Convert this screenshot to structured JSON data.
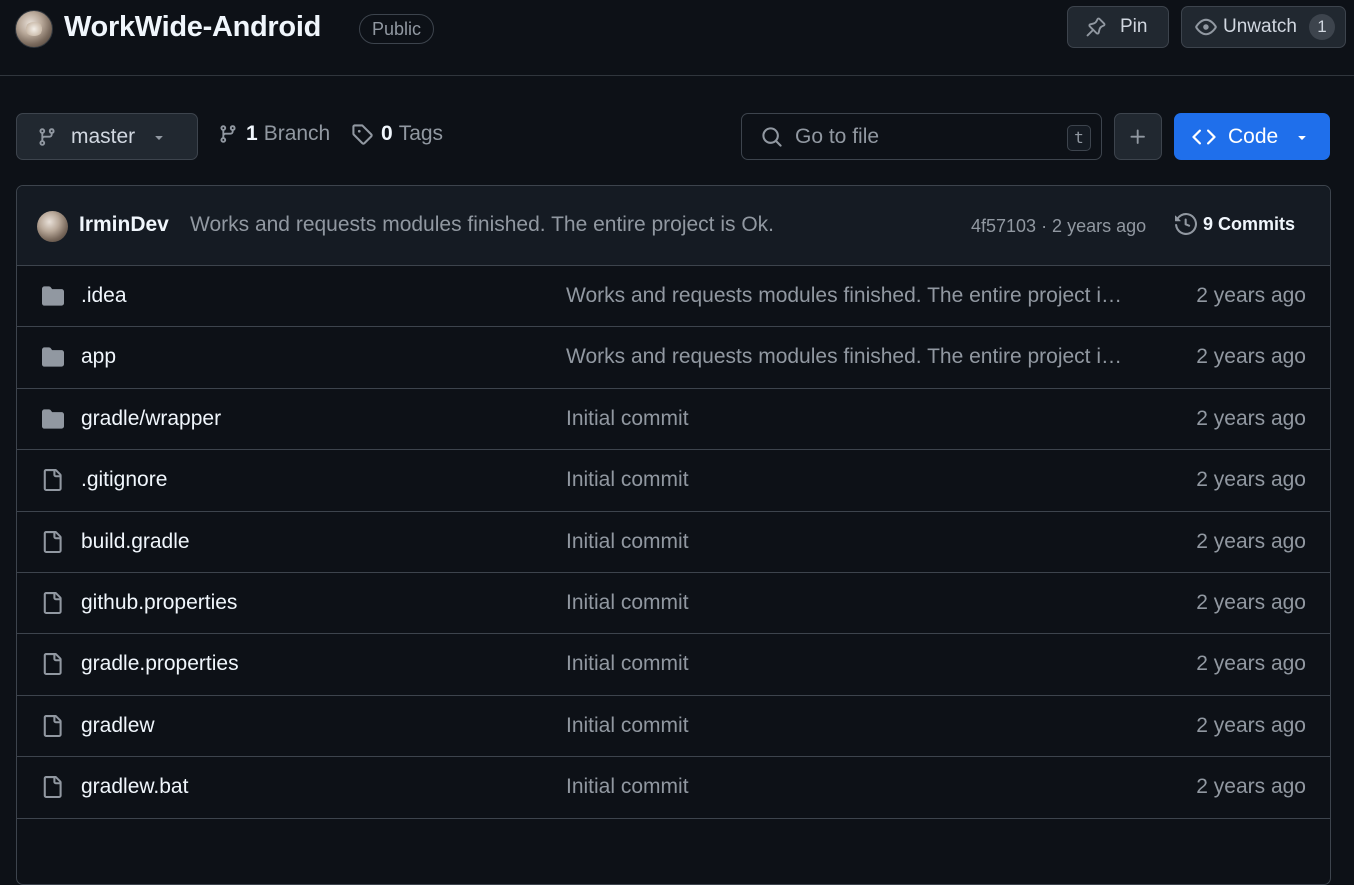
{
  "repo": {
    "name": "WorkWide-Android",
    "visibility": "Public",
    "pin_label": "Pin",
    "watch_label": "Unwatch",
    "watch_count": "1"
  },
  "toolbar": {
    "branch": "master",
    "branch_count": "1",
    "branch_label": "Branch",
    "tag_count": "0",
    "tag_label": "Tags",
    "search_placeholder": "Go to file",
    "search_shortcut": "t",
    "code_label": "Code"
  },
  "latest_commit": {
    "author": "IrminDev",
    "message": "Works and requests modules finished. The entire project is Ok.",
    "meta": "4f57103 · 2 years ago",
    "commits_label": "9 Commits"
  },
  "files": [
    {
      "name": ".idea",
      "type": "dir",
      "commit": "Works and requests modules finished. The entire project is Ok.",
      "age": "2 years ago"
    },
    {
      "name": "app",
      "type": "dir",
      "commit": "Works and requests modules finished. The entire project is Ok.",
      "age": "2 years ago"
    },
    {
      "name": "gradle/wrapper",
      "type": "dir",
      "commit": "Initial commit",
      "age": "2 years ago"
    },
    {
      "name": ".gitignore",
      "type": "file",
      "commit": "Initial commit",
      "age": "2 years ago"
    },
    {
      "name": "build.gradle",
      "type": "file",
      "commit": "Initial commit",
      "age": "2 years ago"
    },
    {
      "name": "github.properties",
      "type": "file",
      "commit": "Initial commit",
      "age": "2 years ago"
    },
    {
      "name": "gradle.properties",
      "type": "file",
      "commit": "Initial commit",
      "age": "2 years ago"
    },
    {
      "name": "gradlew",
      "type": "file",
      "commit": "Initial commit",
      "age": "2 years ago"
    },
    {
      "name": "gradlew.bat",
      "type": "file",
      "commit": "Initial commit",
      "age": "2 years ago"
    }
  ],
  "colors": {
    "background": "#0d1117",
    "border": "#3d444d",
    "accent": "#1f6feb",
    "muted_text": "#9198a1"
  }
}
